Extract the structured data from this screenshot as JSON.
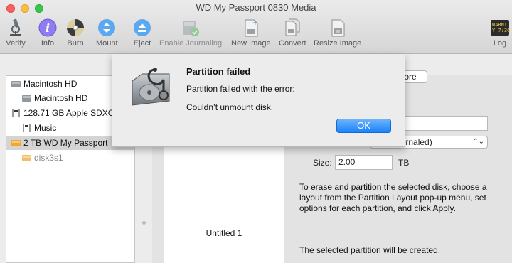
{
  "window": {
    "title": "WD My Passport 0830 Media"
  },
  "toolbar": {
    "verify": "Verify",
    "info": "Info",
    "burn": "Burn",
    "mount": "Mount",
    "eject": "Eject",
    "enable_journaling": "Enable Journaling",
    "new_image": "New Image",
    "convert": "Convert",
    "resize_image": "Resize Image",
    "log": "Log",
    "log_icon_text_1": "WARNI",
    "log_icon_text_2": "Y 7:36"
  },
  "sidebar": {
    "items": [
      {
        "label": "Macintosh HD",
        "icon": "internal-disk-icon"
      },
      {
        "label": "Macintosh HD",
        "icon": "volume-icon"
      },
      {
        "label": "128.71 GB Apple SDXC",
        "icon": "sd-card-icon"
      },
      {
        "label": "Music",
        "icon": "sd-volume-icon"
      },
      {
        "label": "2 TB WD My Passport",
        "icon": "external-disk-icon",
        "selected": true
      },
      {
        "label": "disk3s1",
        "icon": "external-volume-icon",
        "dimmed": true
      }
    ]
  },
  "main": {
    "restore_tab": "store",
    "format_value": "d (Journaled)",
    "size_label": "Size:",
    "size_value": "2.00",
    "size_unit": "TB",
    "volume_name": "Untitled 1",
    "instructions": "To erase and partition the selected disk, choose a layout from the Partition Layout pop-up menu, set options for each partition, and click Apply.",
    "status": "The selected partition will be created."
  },
  "alert": {
    "title": "Partition failed",
    "message": "Partition failed with the error:",
    "detail": "Couldn’t unmount disk.",
    "ok": "OK"
  },
  "colors": {
    "accent": "#1a82fb",
    "selection": "#d4d4d4",
    "partition_border": "#7aa7e0"
  }
}
